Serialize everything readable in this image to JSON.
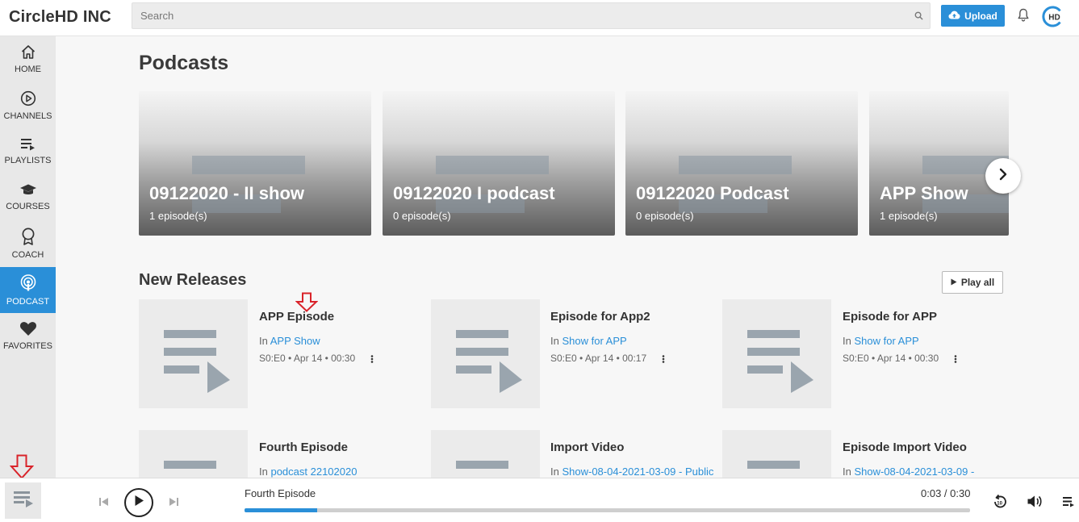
{
  "header": {
    "brand": "CircleHD INC",
    "search_placeholder": "Search",
    "upload_label": "Upload",
    "avatar_text": "HD"
  },
  "sidebar": {
    "items": [
      {
        "label": "HOME",
        "icon": "home-icon"
      },
      {
        "label": "CHANNELS",
        "icon": "play-circle-icon"
      },
      {
        "label": "PLAYLISTS",
        "icon": "playlist-icon"
      },
      {
        "label": "COURSES",
        "icon": "graduation-cap-icon"
      },
      {
        "label": "COACH",
        "icon": "award-icon"
      },
      {
        "label": "PODCAST",
        "icon": "podcast-icon",
        "active": true
      },
      {
        "label": "FAVORITES",
        "icon": "heart-icon"
      }
    ]
  },
  "podcasts": {
    "heading": "Podcasts",
    "cards": [
      {
        "title": "09122020 - II show",
        "count": "1 episode(s)"
      },
      {
        "title": "09122020 I podcast",
        "count": "0 episode(s)"
      },
      {
        "title": "09122020 Podcast",
        "count": "0 episode(s)"
      },
      {
        "title": "APP Show",
        "count": "1 episode(s)"
      }
    ]
  },
  "new_releases": {
    "heading": "New Releases",
    "play_all_label": "Play all",
    "episodes": [
      {
        "title": "APP Episode",
        "in_label": "In",
        "show": "APP Show",
        "meta": "S0:E0 • Apr 14 • 00:30"
      },
      {
        "title": "Episode for App2",
        "in_label": "In",
        "show": "Show for APP",
        "meta": "S0:E0 • Apr 14 • 00:17"
      },
      {
        "title": "Episode for APP",
        "in_label": "In",
        "show": "Show for APP",
        "meta": "S0:E0 • Apr 14 • 00:30"
      },
      {
        "title": "Fourth Episode",
        "in_label": "In",
        "show": "podcast 22102020",
        "meta": ""
      },
      {
        "title": "Import Video",
        "in_label": "In",
        "show": "Show-08-04-2021-03-09 - Public",
        "meta": ""
      },
      {
        "title": "Episode Import Video",
        "in_label": "In",
        "show": "Show-08-04-2021-03-09 -",
        "meta": ""
      }
    ]
  },
  "player": {
    "title": "Fourth Episode",
    "time": "0:03 / 0:30",
    "progress": 0.1
  },
  "colors": {
    "accent": "#2a8fd8",
    "annotation": "#d9232a"
  }
}
